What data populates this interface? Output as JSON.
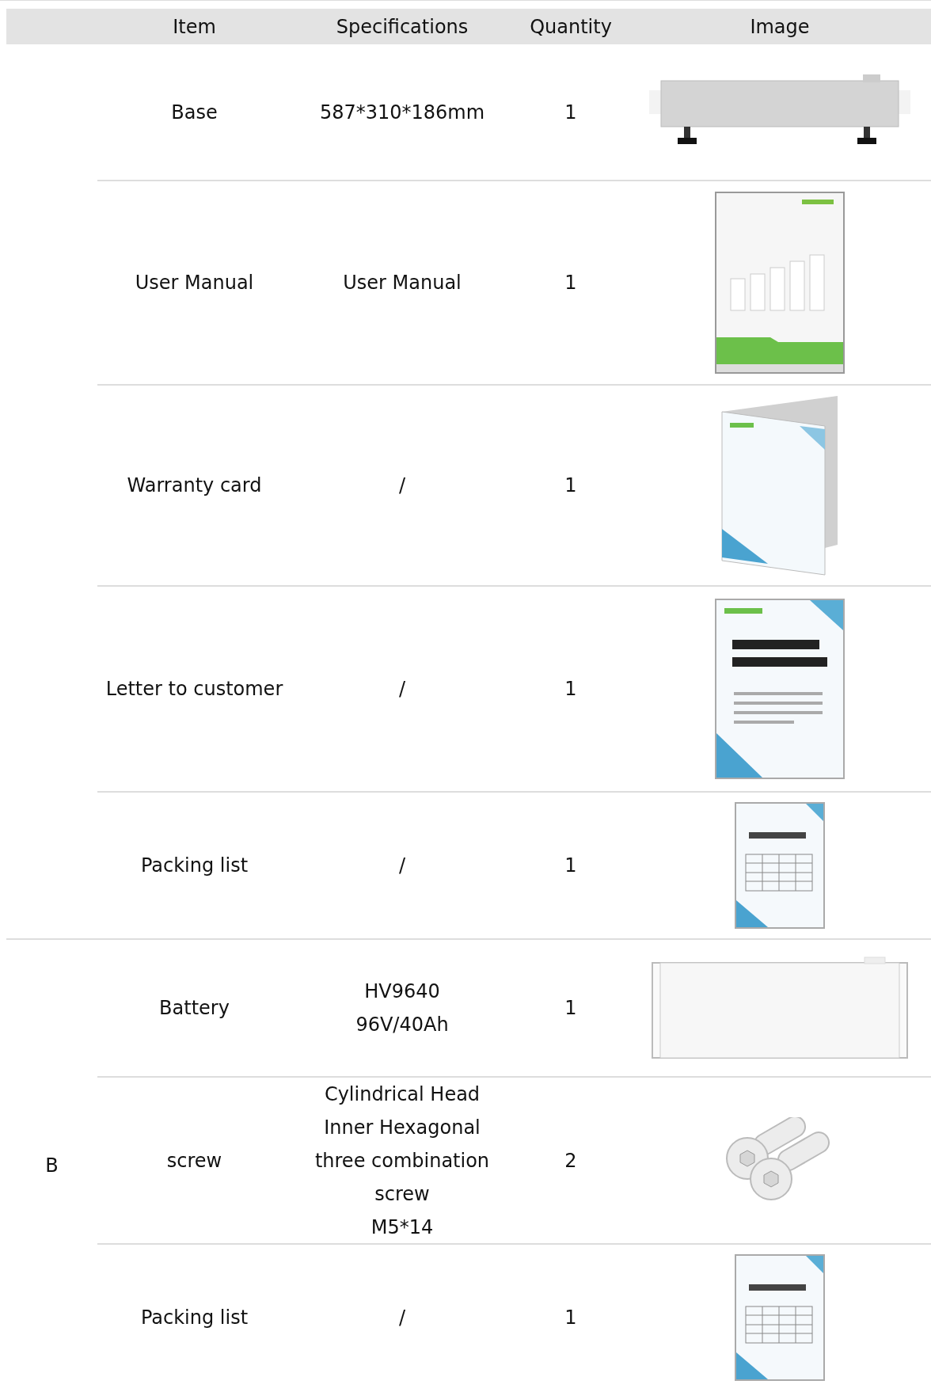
{
  "columns": [
    "Item",
    "Specifications",
    "Quantity",
    "Image"
  ],
  "groups": [
    {
      "rows": [
        {
          "item": "Base",
          "spec": [
            "587*310*186mm"
          ],
          "quantity": "1",
          "kind": "base"
        },
        {
          "item": "User Manual",
          "spec": [
            "User Manual"
          ],
          "quantity": "1",
          "kind": "manual"
        },
        {
          "item": "Warranty card",
          "spec": [
            "/"
          ],
          "quantity": "1",
          "kind": "warranty"
        },
        {
          "item": "Letter to customer",
          "spec": [
            "/"
          ],
          "quantity": "1",
          "kind": "letter"
        },
        {
          "item": "Packing list",
          "spec": [
            "/"
          ],
          "quantity": "1",
          "kind": "packing"
        }
      ]
    },
    {
      "label": "B",
      "rows": [
        {
          "item": "Battery",
          "spec": [
            "HV9640",
            "96V/40Ah"
          ],
          "quantity": "1",
          "kind": "battery"
        },
        {
          "item": "screw",
          "spec": [
            "Cylindrical Head",
            "Inner Hexagonal",
            "three combination",
            "screw",
            "M5*14"
          ],
          "quantity": "2",
          "kind": "screw"
        },
        {
          "item": "Packing list",
          "spec": [
            "/"
          ],
          "quantity": "1",
          "kind": "packing"
        }
      ]
    }
  ]
}
